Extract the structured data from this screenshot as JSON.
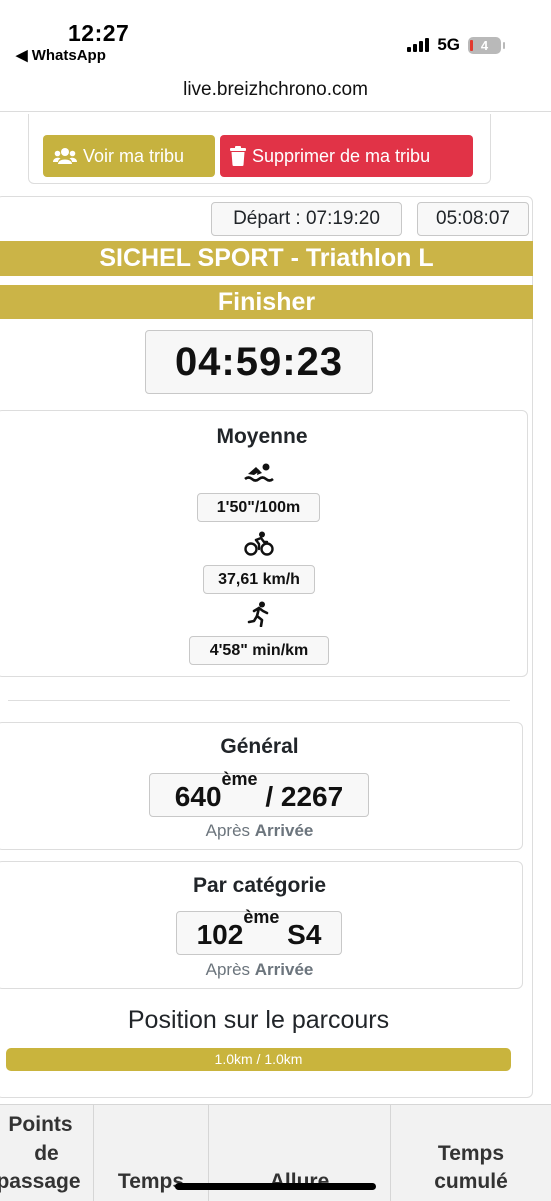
{
  "status_bar": {
    "time": "12:27",
    "back_app": "◀ WhatsApp",
    "network": "5G",
    "battery": "4"
  },
  "browser": {
    "url": "live.breizhchrono.com"
  },
  "tribu": {
    "view_label": "Voir ma tribu",
    "remove_label": "Supprimer de ma tribu"
  },
  "race": {
    "depart": "Départ : 07:19:20",
    "clock": "05:08:07",
    "event_name": "SICHEL SPORT - Triathlon L",
    "status": "Finisher",
    "finish_time": "04:59:23"
  },
  "moyenne": {
    "title": "Moyenne",
    "swim": "1'50\"/100m",
    "bike": "37,61 km/h",
    "run": "4'58\" min/km"
  },
  "general": {
    "title": "Général",
    "rank": "640",
    "suffix": "ème",
    "total": " / 2267",
    "after_label": "Après",
    "after_point": "Arrivée"
  },
  "category": {
    "title": "Par catégorie",
    "rank": "102",
    "suffix": "ème",
    "cat": " S4",
    "after_label": "Après",
    "after_point": "Arrivée"
  },
  "position": {
    "title": "Position sur le parcours",
    "progress_text": "1.0km / 1.0km",
    "progress_fraction": 1.0
  },
  "table_header": {
    "col1_line1": "Points",
    "col1_line2": "de",
    "col1_line3": "passage",
    "col2": "Temps",
    "col3": "Allure",
    "col4_line1": "Temps",
    "col4_line2": "cumulé"
  },
  "colors": {
    "gold": "#cbb447",
    "red": "#e13347"
  },
  "icons": {
    "swim": "swimmer-icon",
    "bike": "biker-icon",
    "run": "runner-icon",
    "tribu": "users-icon",
    "trash": "trash-icon"
  }
}
